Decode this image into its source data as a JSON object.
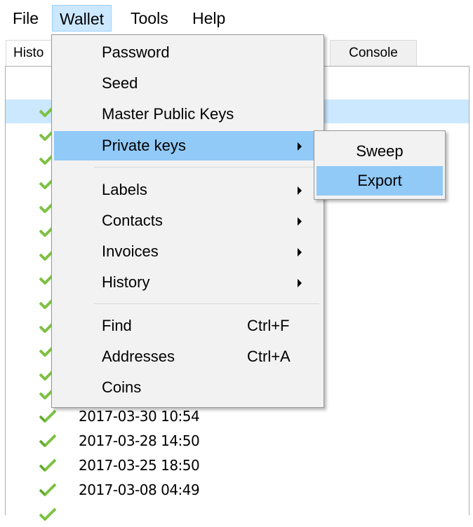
{
  "menubar": {
    "items": [
      {
        "label": "File"
      },
      {
        "label": "Wallet"
      },
      {
        "label": "Tools"
      },
      {
        "label": "Help"
      }
    ]
  },
  "tabs": {
    "history_label": "Histo",
    "console_label": "Console"
  },
  "history": {
    "rows": [
      {
        "date": "2017-03-30 10:54"
      },
      {
        "date": "2017-03-28 14:50"
      },
      {
        "date": "2017-03-25 18:50"
      },
      {
        "date": "2017-03-08 04:49"
      }
    ]
  },
  "wallet_menu": {
    "password": "Password",
    "seed": "Seed",
    "master_public_keys": "Master Public Keys",
    "private_keys": "Private keys",
    "labels": "Labels",
    "contacts": "Contacts",
    "invoices": "Invoices",
    "history": "History",
    "find": "Find",
    "find_shortcut": "Ctrl+F",
    "addresses": "Addresses",
    "addresses_shortcut": "Ctrl+A",
    "coins": "Coins"
  },
  "private_keys_submenu": {
    "sweep": "Sweep",
    "export": "Export"
  },
  "colors": {
    "menu_highlight": "#91c9f7",
    "row_highlight": "#cce8ff",
    "check_green": "#7cc243"
  },
  "icons": {
    "confirmed": "checkmark-icon",
    "submenu_arrow": "chevron-right-icon"
  }
}
